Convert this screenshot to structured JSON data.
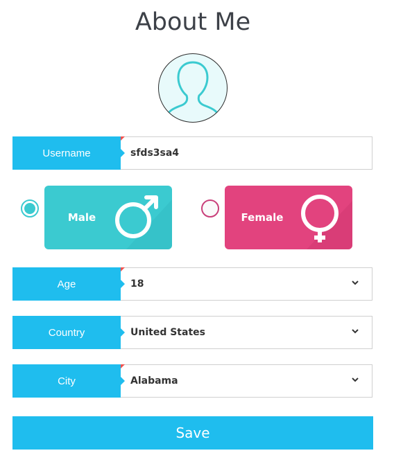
{
  "page": {
    "title": "About Me"
  },
  "avatar": {
    "icon": "user-silhouette-icon"
  },
  "username": {
    "label": "Username",
    "value": "sfds3sa4"
  },
  "gender": {
    "male": {
      "label": "Male",
      "icon": "male-symbol-icon",
      "selected": true,
      "color": "#3bcad0"
    },
    "female": {
      "label": "Female",
      "icon": "female-symbol-icon",
      "selected": false,
      "color": "#e2437e"
    }
  },
  "age": {
    "label": "Age",
    "value": "18"
  },
  "country": {
    "label": "Country",
    "value": "United States"
  },
  "city": {
    "label": "City",
    "value": "Alabama"
  },
  "save": {
    "label": "Save"
  },
  "colors": {
    "accent": "#1fbdee",
    "corner_mark": "#ef5350"
  }
}
